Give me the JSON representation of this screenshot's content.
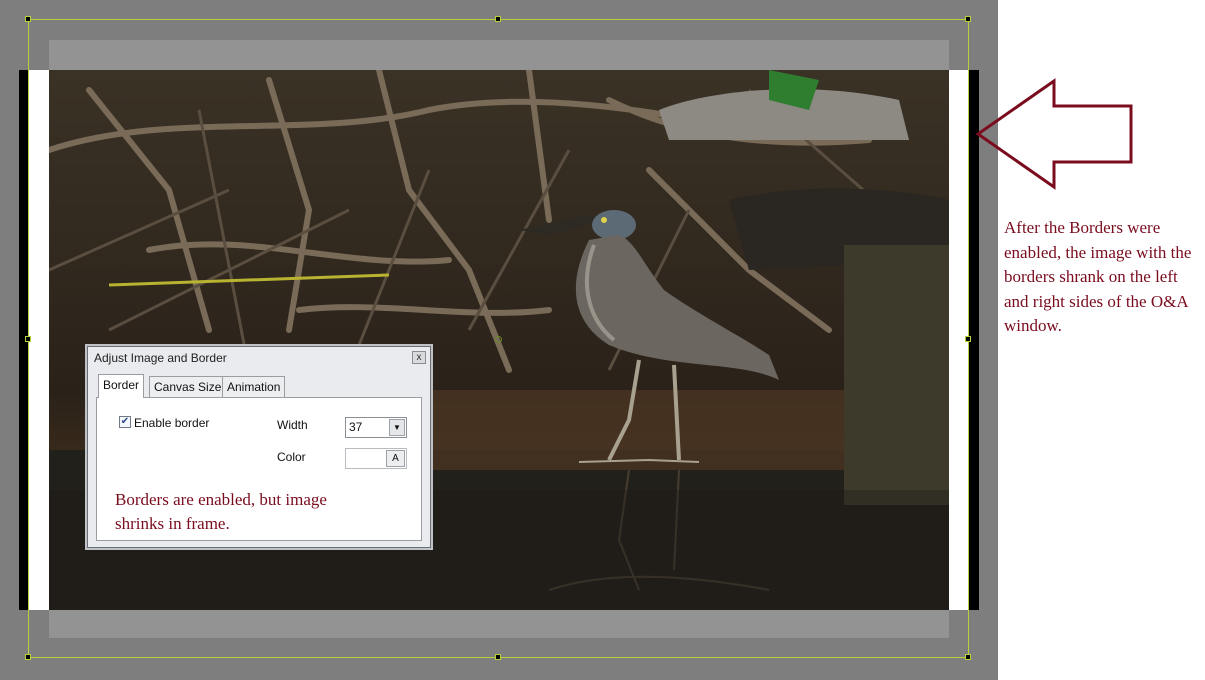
{
  "dialog": {
    "title": "Adjust Image and Border",
    "close_label": "x",
    "tabs": [
      {
        "label": "Border",
        "active": true
      },
      {
        "label": "Canvas Size",
        "active": false
      },
      {
        "label": "Animation",
        "active": false
      }
    ],
    "enable_border_label": "Enable border",
    "enable_border_checked": true,
    "width_label": "Width",
    "width_value": "37",
    "color_label": "Color",
    "color_button_label": "A",
    "note": "Borders are enabled, but image shrinks in frame."
  },
  "annotation": {
    "text": "After the Borders were enabled, the image with the borders shrank on the left and right sides of the O&A window."
  },
  "colors": {
    "annotation": "#7a0c1e",
    "selection": "#b6d23a",
    "canvas": "#7e7e7e"
  },
  "icons": {
    "arrow": "left-arrow-outline-icon",
    "dropdown": "chevron-down-icon",
    "checkbox": "checkmark-icon"
  }
}
